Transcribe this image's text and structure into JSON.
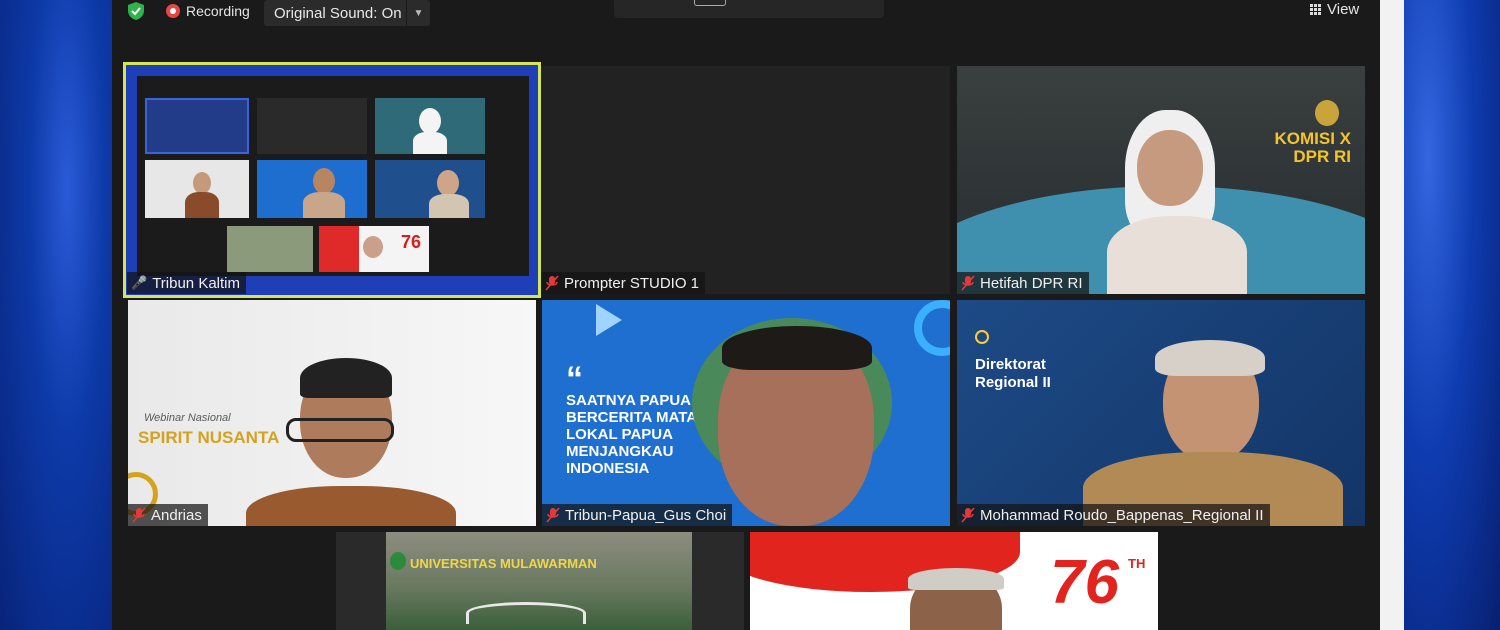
{
  "toolbar": {
    "recording_label": "Recording",
    "sound_label": "Original Sound: On",
    "view_label": "View"
  },
  "participants": [
    {
      "name": "Tribun Kaltim",
      "muted": false
    },
    {
      "name": "Prompter STUDIO 1",
      "muted": true
    },
    {
      "name": "Hetifah DPR RI",
      "muted": true
    },
    {
      "name": "Andrias",
      "muted": true
    },
    {
      "name": "Tribun-Papua_Gus Choi",
      "muted": true
    },
    {
      "name": "Mohammad Roudo_Bappenas_Regional II",
      "muted": true
    }
  ],
  "backgrounds": {
    "hetifah_title_line1": "KOMISI X",
    "hetifah_title_line2": "DPR RI",
    "andrias_webinar": "Webinar Nasional",
    "andrias_title": "SPIRIT NUSANTA",
    "papua_quote": "SAATNYA PAPUA BERCERITA MATA LOKAL PAPUA MENJANGKAU INDONESIA",
    "bappenas_line1": "Direktorat",
    "bappenas_line2": "Regional II",
    "unmul_banner": "UNIVERSITAS MULAWARMAN",
    "hut_number": "76",
    "hut_suffix": "TH"
  },
  "colors": {
    "active_speaker": "#d6e45a",
    "muted_mic": "#e03b3b",
    "recording": "#e84646"
  }
}
